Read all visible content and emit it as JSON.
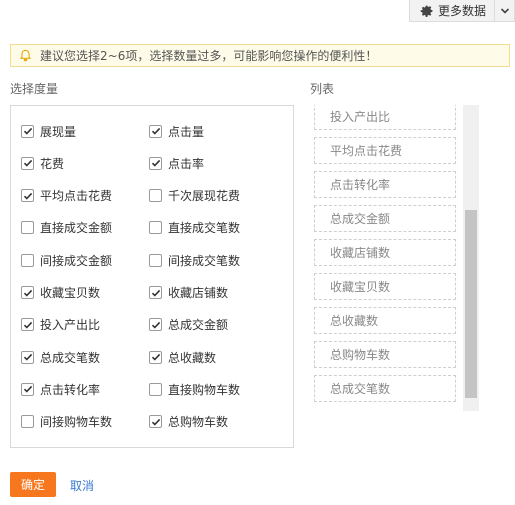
{
  "topbar": {
    "more_label": "更多数据"
  },
  "warning": {
    "text": "建议您选择2~6项，选择数量过多，可能影响您操作的便利性！"
  },
  "metrics_title": "选择度量",
  "list_title": "列表",
  "metrics": [
    {
      "label": "展现量",
      "checked": true
    },
    {
      "label": "点击量",
      "checked": true
    },
    {
      "label": "花费",
      "checked": true
    },
    {
      "label": "点击率",
      "checked": true
    },
    {
      "label": "平均点击花费",
      "checked": true
    },
    {
      "label": "千次展现花费",
      "checked": false
    },
    {
      "label": "直接成交金额",
      "checked": false
    },
    {
      "label": "直接成交笔数",
      "checked": false
    },
    {
      "label": "间接成交金额",
      "checked": false
    },
    {
      "label": "间接成交笔数",
      "checked": false
    },
    {
      "label": "收藏宝贝数",
      "checked": true
    },
    {
      "label": "收藏店铺数",
      "checked": true
    },
    {
      "label": "投入产出比",
      "checked": true
    },
    {
      "label": "总成交金额",
      "checked": true
    },
    {
      "label": "总成交笔数",
      "checked": true
    },
    {
      "label": "总收藏数",
      "checked": true
    },
    {
      "label": "点击转化率",
      "checked": true
    },
    {
      "label": "直接购物车数",
      "checked": false
    },
    {
      "label": "间接购物车数",
      "checked": false
    },
    {
      "label": "总购物车数",
      "checked": true
    }
  ],
  "list_items": [
    "投入产出比",
    "平均点击花费",
    "点击转化率",
    "总成交金额",
    "收藏店铺数",
    "收藏宝贝数",
    "总收藏数",
    "总购物车数",
    "总成交笔数"
  ],
  "actions": {
    "ok_label": "确定",
    "cancel_label": "取消"
  },
  "colors": {
    "accent": "#f7771e",
    "link": "#3a7ad5",
    "warn_bg": "#fefce8"
  }
}
